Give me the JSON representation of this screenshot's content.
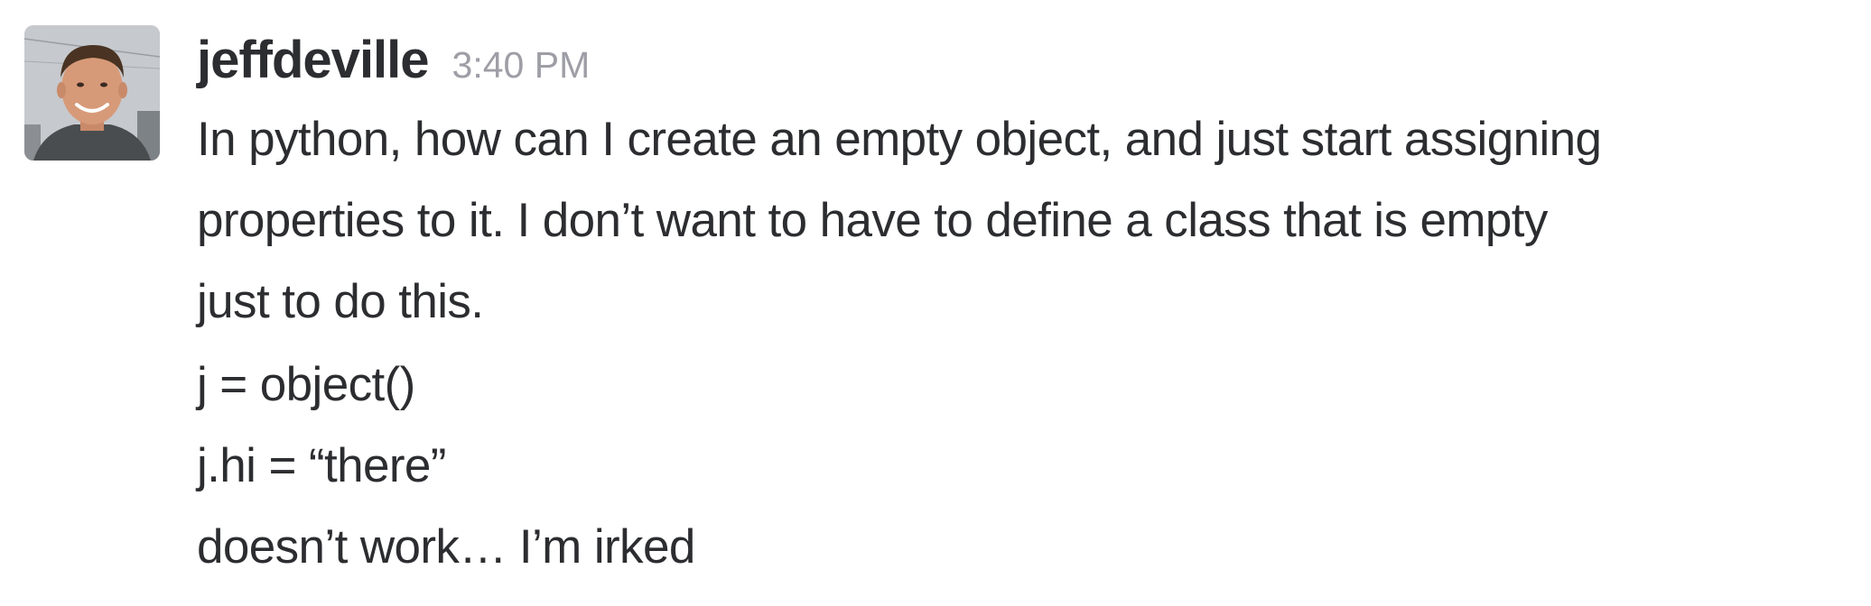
{
  "message": {
    "author": "jeffdeville",
    "timestamp": "3:40 PM",
    "paragraph_lines": [
      "In python, how can I create an empty object, and just start assigning",
      "properties to it.  I don’t want to have to define a class that is empty",
      "just to do this."
    ],
    "code_lines": [
      "j = object()",
      "j.hi = “there”",
      "doesn’t work…  I’m irked"
    ]
  }
}
